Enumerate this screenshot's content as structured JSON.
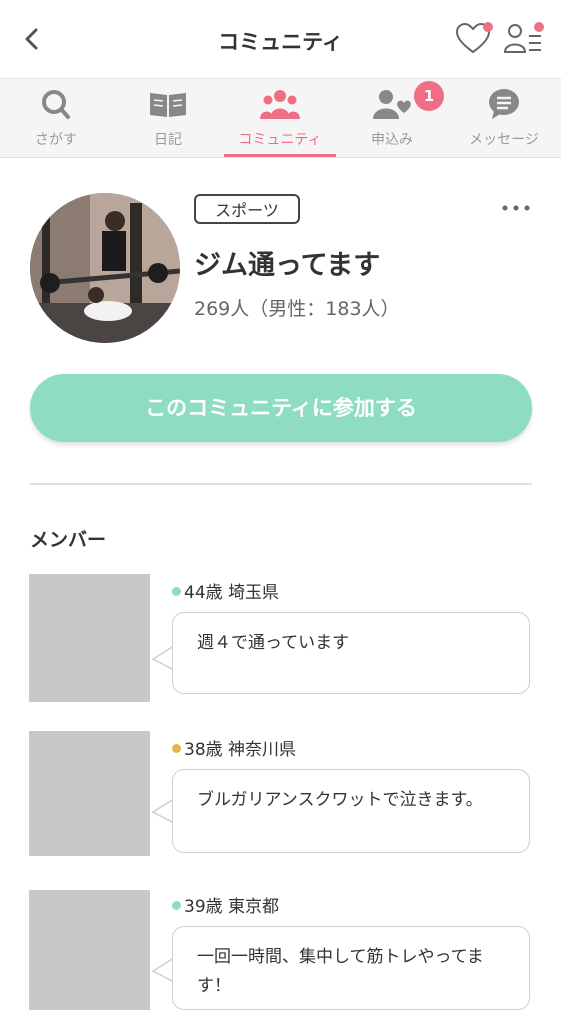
{
  "header": {
    "title": "コミュニティ"
  },
  "tabs": [
    {
      "label": "さがす",
      "icon": "search-icon"
    },
    {
      "label": "日記",
      "icon": "book-icon"
    },
    {
      "label": "コミュニティ",
      "icon": "community-icon",
      "active": true
    },
    {
      "label": "申込み",
      "icon": "application-icon",
      "badge": "1"
    },
    {
      "label": "メッセージ",
      "icon": "message-icon"
    }
  ],
  "community": {
    "category": "スポーツ",
    "name": "ジム通ってます",
    "member_count": "269人（男性：183人）",
    "join_label": "このコミュニティに参加する"
  },
  "members_heading": "メンバー",
  "members": [
    {
      "meta": "44歳 埼玉県",
      "status_color": "#8fdcc5",
      "message": "週４で通っています"
    },
    {
      "meta": "38歳 神奈川県",
      "status_color": "#e0b848",
      "message": "ブルガリアンスクワットで泣きます。"
    },
    {
      "meta": "39歳 東京都",
      "status_color": "#8fdcc5",
      "message": "一回一時間、集中して筋トレやってます！"
    }
  ],
  "colors": {
    "accent": "#ee6f83",
    "join_button": "#8fdcc5",
    "inactive_tab": "#999999"
  }
}
